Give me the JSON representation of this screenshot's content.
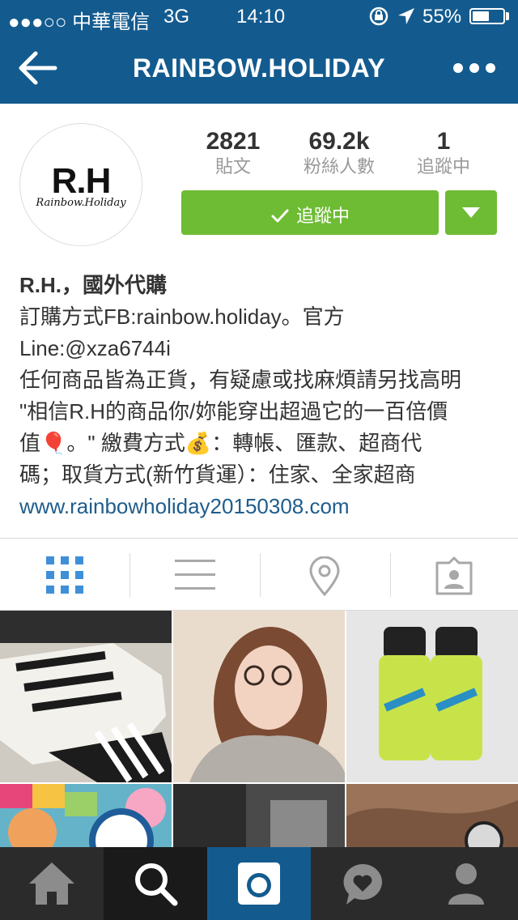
{
  "status_bar": {
    "carrier": "●●●○○ 中華電信",
    "network": "3G",
    "time": "14:10",
    "battery": "55%",
    "battery_level": 0.55
  },
  "nav": {
    "title": "RAINBOW.HOLIDAY"
  },
  "profile": {
    "avatar_main": "R.H",
    "avatar_sub": "Rainbow.Holiday",
    "stats": [
      {
        "value": "2821",
        "label": "貼文"
      },
      {
        "value": "69.2k",
        "label": "粉絲人數"
      },
      {
        "value": "1",
        "label": "追蹤中"
      }
    ],
    "follow_label": "追蹤中"
  },
  "bio": {
    "name": "R.H.，國外代購",
    "lines": [
      "訂購方式FB:rainbow.holiday。官方",
      "Line:@xza6744i",
      "任何商品皆為正貨，有疑慮或找麻煩請另找高明",
      "\"相信R.H的商品你/妳能穿出超過它的一百倍價",
      "值🎈。\" 繳費方式💰：轉帳、匯款、超商代",
      "碼；取貨方式(新竹貨運）：住家、全家超商"
    ],
    "link": "www.rainbowholiday20150308.com"
  },
  "tabs": [
    {
      "icon": "grid-icon",
      "active": true
    },
    {
      "icon": "list-icon",
      "active": false
    },
    {
      "icon": "location-pin-icon",
      "active": false
    },
    {
      "icon": "tagged-photos-icon",
      "active": false
    }
  ],
  "tab_bar": [
    {
      "icon": "home-icon",
      "active": false
    },
    {
      "icon": "search-icon",
      "active": true
    },
    {
      "icon": "camera-icon",
      "active": false
    },
    {
      "icon": "activity-heart-icon",
      "active": false
    },
    {
      "icon": "profile-icon",
      "active": false
    }
  ],
  "colors": {
    "brand_blue": "#135b8f",
    "follow_green": "#6ebb34",
    "link_blue": "#1e5d8c",
    "tab_active_blue": "#3f8fd8",
    "tab_bar_dark": "#2b2b2b"
  }
}
